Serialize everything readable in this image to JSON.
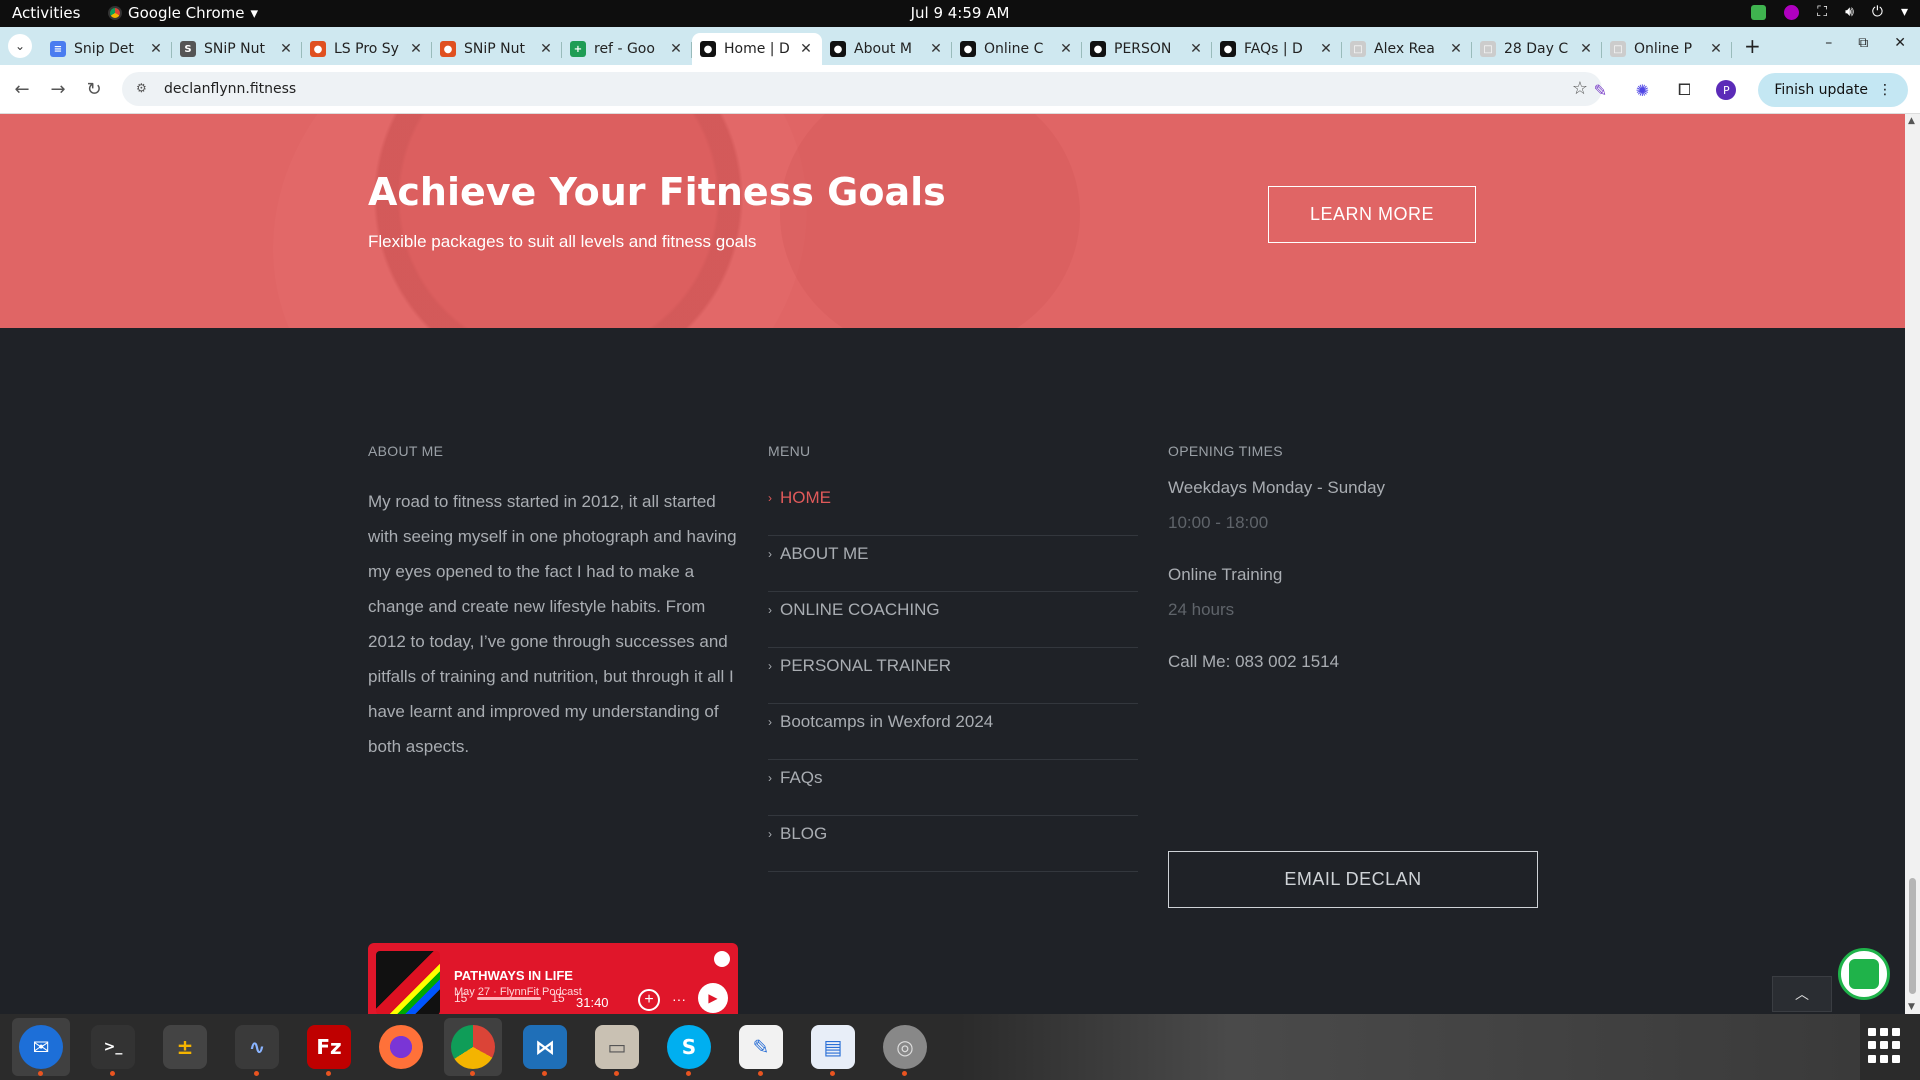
{
  "system": {
    "activities": "Activities",
    "app_name": "Google Chrome",
    "clock": "Jul 9  4:59 AM"
  },
  "tabs": [
    {
      "title": "Snip Det",
      "fav_color": "#4a7cf0",
      "fav_glyph": "≡"
    },
    {
      "title": "SNiP Nut",
      "fav_color": "#555555",
      "fav_glyph": "S"
    },
    {
      "title": "LS Pro Sy",
      "fav_color": "#e05020",
      "fav_glyph": "●"
    },
    {
      "title": "SNiP Nut",
      "fav_color": "#e05020",
      "fav_glyph": "●"
    },
    {
      "title": "ref - Goo",
      "fav_color": "#1f9d55",
      "fav_glyph": "+"
    },
    {
      "title": "Home | D",
      "fav_color": "#111111",
      "fav_glyph": "●",
      "active": true
    },
    {
      "title": "About M",
      "fav_color": "#111111",
      "fav_glyph": "●"
    },
    {
      "title": "Online C",
      "fav_color": "#111111",
      "fav_glyph": "●"
    },
    {
      "title": "PERSON",
      "fav_color": "#111111",
      "fav_glyph": "●"
    },
    {
      "title": "FAQs | D",
      "fav_color": "#111111",
      "fav_glyph": "●"
    },
    {
      "title": "Alex Rea",
      "fav_color": "#cccccc",
      "fav_glyph": "□"
    },
    {
      "title": "28 Day C",
      "fav_color": "#cccccc",
      "fav_glyph": "□"
    },
    {
      "title": "Online P",
      "fav_color": "#cccccc",
      "fav_glyph": "□"
    }
  ],
  "omnibox": {
    "url": "declanflynn.fitness",
    "finish_update": "Finish update",
    "profile_initial": "P"
  },
  "hero": {
    "title": "Achieve Your Fitness Goals",
    "subtitle": "Flexible packages to suit all levels and fitness goals",
    "button": "LEARN MORE"
  },
  "footer": {
    "about_heading": "ABOUT ME",
    "about_text": "My road to fitness started in 2012, it all started with seeing myself in one photograph and having my eyes opened to the fact I had to make a change and create new lifestyle habits. From 2012 to today, I’ve gone through successes and pitfalls of training and nutrition, but through it all I have learnt and improved my understanding of both aspects.",
    "menu_heading": "MENU",
    "menu": [
      {
        "label": "HOME",
        "active": true
      },
      {
        "label": "ABOUT ME"
      },
      {
        "label": "ONLINE COACHING"
      },
      {
        "label": "PERSONAL TRAINER"
      },
      {
        "label": "Bootcamps in Wexford 2024"
      },
      {
        "label": "FAQs"
      },
      {
        "label": "BLOG"
      }
    ],
    "hours_heading": "OPENING TIMES",
    "weekdays_label": "Weekdays Monday - Sunday",
    "weekdays_hours": "10:00 - 18:00",
    "online_label": "Online Training",
    "online_hours": "24 hours",
    "call": "Call Me: 083 002 1514",
    "email_button": "EMAIL DECLAN"
  },
  "podcast": {
    "episode": "PATHWAYS IN LIFE",
    "meta": "May 27 · FlynnFit Podcast",
    "duration": "31:40",
    "rewind": "15",
    "forward": "15"
  },
  "colors": {
    "accent": "#e05a5a",
    "hero_bg": "#e06565",
    "footer_bg": "#1f2227",
    "spotify_red": "#e0162a"
  }
}
